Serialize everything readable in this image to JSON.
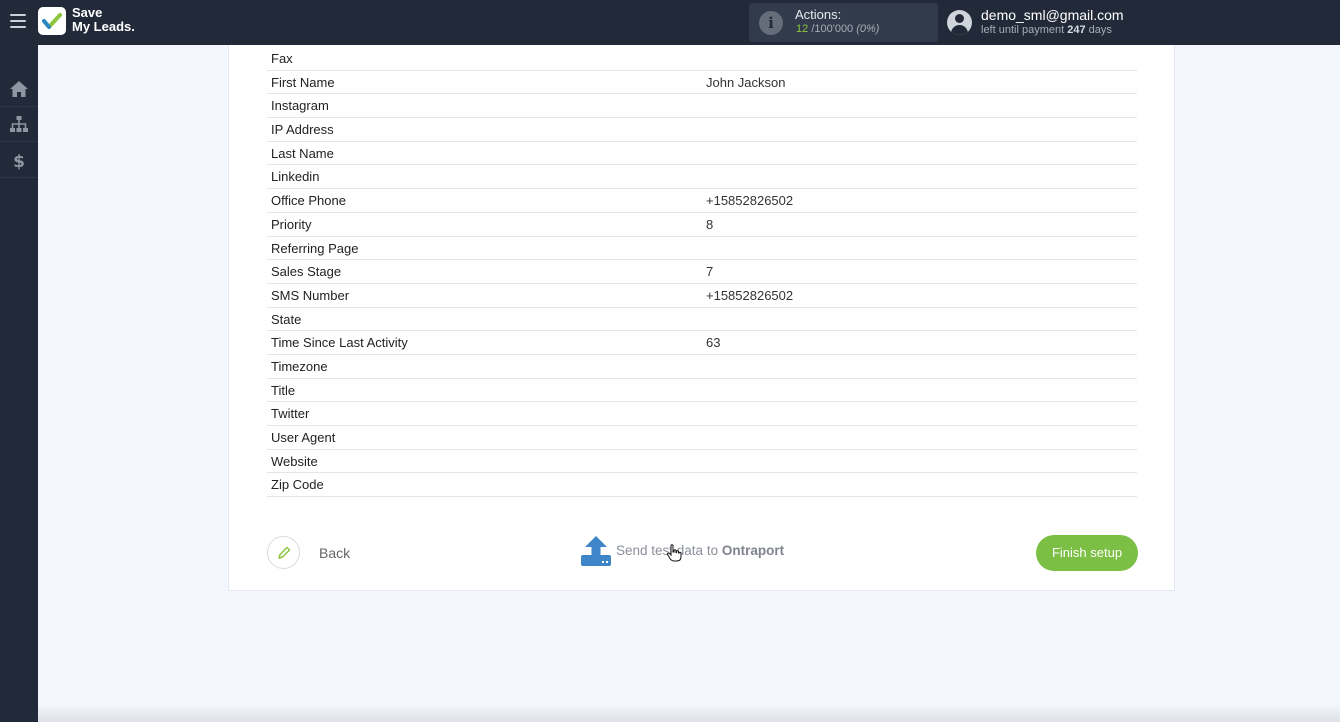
{
  "app": {
    "logo_line1": "Save",
    "logo_line2": "My Leads.",
    "brand_color": "#8dc63f"
  },
  "actions": {
    "label": "Actions:",
    "used": "12",
    "limit": "/100'000",
    "percent": "(0%)"
  },
  "user": {
    "email": "demo_sml@gmail.com",
    "sub_prefix": "left until payment",
    "days": "247",
    "sub_suffix": "days"
  },
  "sidebar": {
    "items": [
      {
        "icon": "home-icon"
      },
      {
        "icon": "sitemap-icon"
      },
      {
        "icon": "dollar-icon"
      }
    ]
  },
  "fields": [
    {
      "label": "Fax",
      "value": ""
    },
    {
      "label": "First Name",
      "value": "John Jackson"
    },
    {
      "label": "Instagram",
      "value": ""
    },
    {
      "label": "IP Address",
      "value": ""
    },
    {
      "label": "Last Name",
      "value": ""
    },
    {
      "label": "Linkedin",
      "value": ""
    },
    {
      "label": "Office Phone",
      "value": "+15852826502"
    },
    {
      "label": "Priority",
      "value": "8"
    },
    {
      "label": "Referring Page",
      "value": ""
    },
    {
      "label": "Sales Stage",
      "value": "7"
    },
    {
      "label": "SMS Number",
      "value": "+15852826502"
    },
    {
      "label": "State",
      "value": ""
    },
    {
      "label": "Time Since Last Activity",
      "value": "63"
    },
    {
      "label": "Timezone",
      "value": ""
    },
    {
      "label": "Title",
      "value": ""
    },
    {
      "label": "Twitter",
      "value": ""
    },
    {
      "label": "User Agent",
      "value": ""
    },
    {
      "label": "Website",
      "value": ""
    },
    {
      "label": "Zip Code",
      "value": ""
    }
  ],
  "footer": {
    "back_label": "Back",
    "send_prefix": "Send test data to",
    "send_target": "Ontraport",
    "finish_label": "Finish setup"
  }
}
